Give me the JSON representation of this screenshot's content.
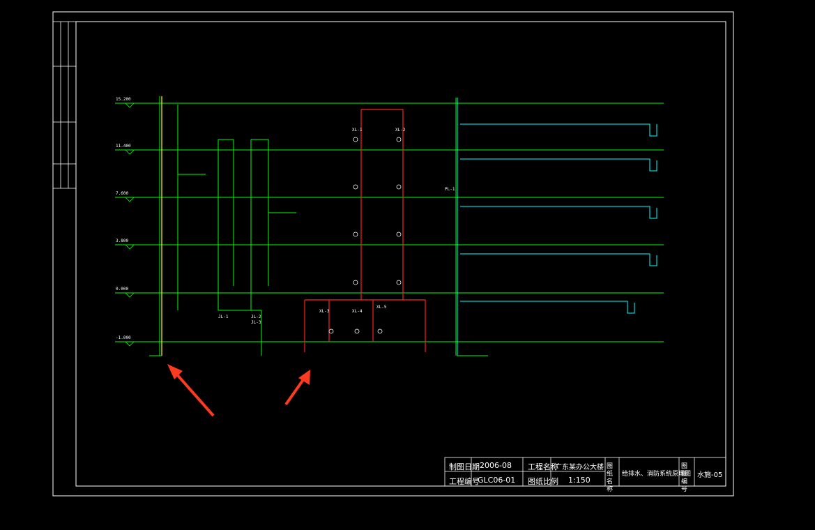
{
  "colors": {
    "background": "#000000",
    "frame": "#ffffff",
    "supply_pipe": "#00ff00",
    "fire_pipe": "#ff2020",
    "branch_pipe": "#00ffff",
    "level_line": "#00ff00",
    "arrow": "#ff3b1f"
  },
  "levels": {
    "roof": "15.200",
    "floor3": "11.400",
    "floor2": "7.600",
    "floor1": "3.800",
    "ground": "0.000",
    "basement": "-1.000"
  },
  "risers": {
    "jl1": "JL-1",
    "jl2": "JL-2",
    "jl3": "JL-3",
    "pl1": "PL-1",
    "xl1": "XL-1",
    "xl2": "XL-2",
    "xl3": "XL-3",
    "xl4": "XL-4",
    "xl5": "XL-5"
  },
  "title_block": {
    "date_label": "制图日期",
    "date_value": "2006-08",
    "project_name_label": "工程名称",
    "project_name_value": "广东某办公大楼",
    "drawing_no_label": "工程编号",
    "drawing_no_value": "GLC06-01",
    "scale_label": "图纸比例",
    "scale_value": "1:150",
    "drawing_name_label": "图纸名称",
    "drawing_name_value": "给排水、消防系统原理图",
    "sheet_label": "图纸编号",
    "sheet_value": "水施-05"
  },
  "annotations": [
    {
      "id": "arrow-left",
      "kind": "red-arrow"
    },
    {
      "id": "arrow-right",
      "kind": "red-arrow"
    }
  ]
}
